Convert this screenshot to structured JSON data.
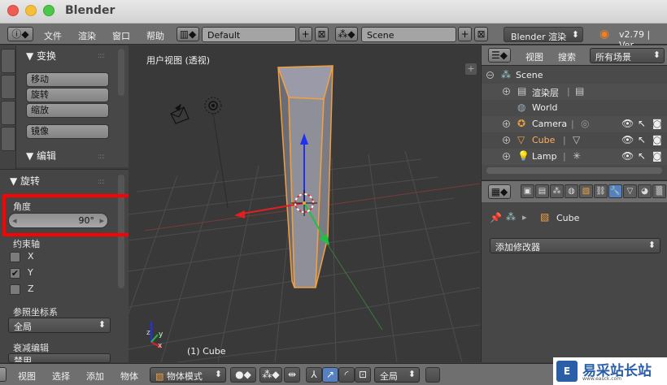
{
  "window": {
    "title": "Blender"
  },
  "header": {
    "menus": [
      "文件",
      "渲染",
      "窗口",
      "帮助"
    ],
    "layout_name": "Default",
    "scene_name": "Scene",
    "render_engine": "Blender 渲染",
    "version": "v2.79 | Ver"
  },
  "tool_panel": {
    "transform_title": "▼ 变换",
    "buttons": [
      "移动",
      "旋转",
      "缩放"
    ],
    "mirror_button": "镜像",
    "edit_title": "▼ 编辑"
  },
  "redo_panel": {
    "title": "▼ 旋转",
    "angle_label": "角度",
    "angle_value": "90°",
    "constraint_label": "约束轴",
    "axes": [
      {
        "label": "X",
        "checked": false
      },
      {
        "label": "Y",
        "checked": true
      },
      {
        "label": "Z",
        "checked": false
      }
    ],
    "orientation_label": "参照坐标系",
    "orientation_value": "全局",
    "falloff_label": "衰减编辑",
    "falloff_value": "禁用"
  },
  "viewport": {
    "title": "用户视图 (透视)",
    "object_info": "(1) Cube"
  },
  "outliner": {
    "view_label": "视图",
    "search_label": "搜索",
    "filter_value": "所有场景",
    "rows": [
      {
        "label": "Scene",
        "icon": "scene-icon"
      },
      {
        "label": "渲染层",
        "icon": "render-layers-icon"
      },
      {
        "label": "World",
        "icon": "world-icon"
      },
      {
        "label": "Camera",
        "icon": "camera-icon"
      },
      {
        "label": "Cube",
        "icon": "mesh-icon"
      },
      {
        "label": "Lamp",
        "icon": "lamp-icon"
      }
    ]
  },
  "properties": {
    "object_name": "Cube",
    "add_modifier": "添加修改器"
  },
  "bottombar": {
    "menus": [
      "视图",
      "选择",
      "添加",
      "物体"
    ],
    "mode": "物体模式",
    "orientation": "全局"
  },
  "watermark": {
    "text": "易采站长站",
    "url": "www.easck.com"
  },
  "colors": {
    "selection_outline": "#f0a040",
    "highlight_box": "#ff0000",
    "x_axis": "#e02020",
    "y_axis": "#20c040",
    "z_axis": "#2030f0"
  }
}
